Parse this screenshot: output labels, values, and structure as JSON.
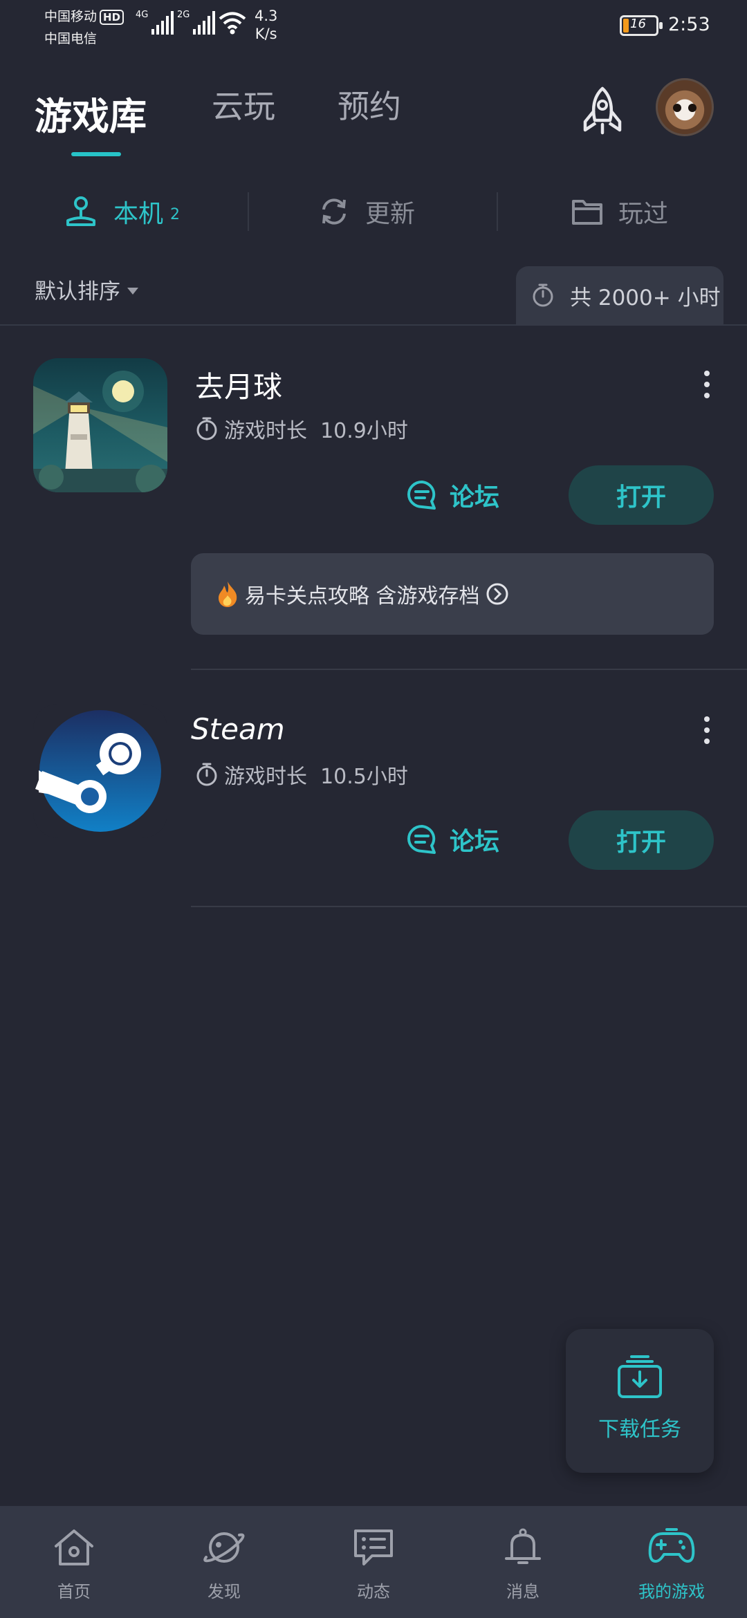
{
  "status_bar": {
    "carrier_1": "中国移动",
    "hd": "HD",
    "carrier_2": "中国电信",
    "net_1": "4G",
    "net_2": "2G",
    "speed_value": "4.3",
    "speed_unit": "K/s",
    "battery": "16",
    "battery_color": "#f39a1c",
    "time": "2:53"
  },
  "top_tabs": [
    {
      "label": "游戏库",
      "active": true
    },
    {
      "label": "云玩",
      "active": false
    },
    {
      "label": "预约",
      "active": false
    }
  ],
  "sub_tabs": [
    {
      "label": "本机",
      "count": "2",
      "icon": "joystick-icon",
      "active": true
    },
    {
      "label": "更新",
      "icon": "refresh-icon",
      "active": false
    },
    {
      "label": "玩过",
      "icon": "folder-icon",
      "active": false
    }
  ],
  "sort": {
    "label": "默认排序"
  },
  "total_time": {
    "label": "共 2000+ 小时"
  },
  "games": [
    {
      "title": "去月球",
      "playtime_label": "游戏时长",
      "playtime_value": "10.9小时",
      "forum": "论坛",
      "open": "打开",
      "promo": "易卡关点攻略 含游戏存档"
    },
    {
      "title": "Steam",
      "playtime_label": "游戏时长",
      "playtime_value": "10.5小时",
      "forum": "论坛",
      "open": "打开"
    }
  ],
  "download_task": {
    "label": "下载任务"
  },
  "bottom_nav": [
    {
      "label": "首页",
      "icon": "home-icon",
      "active": false
    },
    {
      "label": "发现",
      "icon": "planet-icon",
      "active": false
    },
    {
      "label": "动态",
      "icon": "message-icon",
      "active": false
    },
    {
      "label": "消息",
      "icon": "bell-icon",
      "active": false
    },
    {
      "label": "我的游戏",
      "icon": "gamepad-icon",
      "active": true
    }
  ],
  "colors": {
    "background": "#252733",
    "accent": "#2ec4c9",
    "nav_bar": "#343846"
  }
}
